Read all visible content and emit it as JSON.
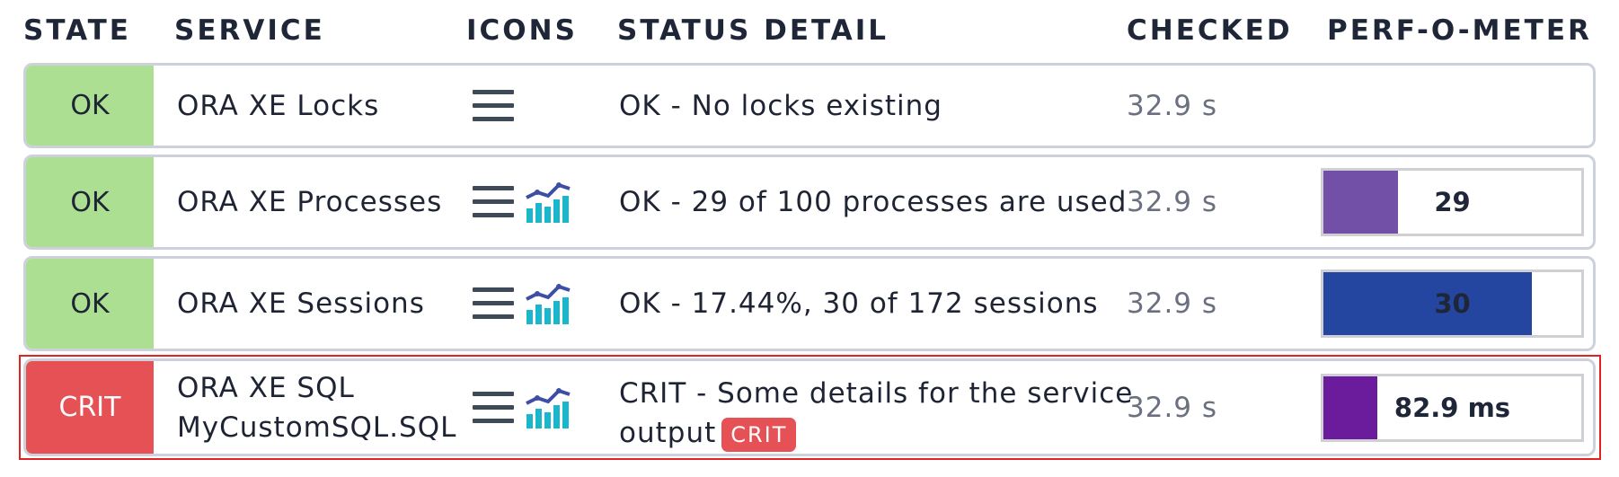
{
  "headers": {
    "state": "STATE",
    "service": "SERVICE",
    "icons": "ICONS",
    "status_detail": "STATUS DETAIL",
    "checked": "CHECKED",
    "perf": "PERF-O-METER"
  },
  "colors": {
    "ok": "#addf93",
    "crit": "#e55155",
    "perf_processes": "#7250a8",
    "perf_sessions": "#2446a0",
    "perf_sql": "#6a1c9c",
    "highlight_border": "#e12222"
  },
  "rows": [
    {
      "state": "OK",
      "service": "ORA XE Locks",
      "icons": [
        "menu-icon"
      ],
      "detail": "OK - No locks existing",
      "checked": "32.9 s"
    },
    {
      "state": "OK",
      "service": "ORA XE Processes",
      "icons": [
        "menu-icon",
        "graph-icon"
      ],
      "detail": "OK - 29 of 100 processes are used",
      "checked": "32.9 s",
      "perf": {
        "label": "29",
        "fraction": 0.29
      }
    },
    {
      "state": "OK",
      "service": "ORA XE Sessions",
      "icons": [
        "menu-icon",
        "graph-icon"
      ],
      "detail": "OK - 17.44%, 30 of 172 sessions",
      "checked": "32.9 s",
      "perf": {
        "label": "30",
        "fraction": 0.81
      }
    },
    {
      "state": "CRIT",
      "service_line1": "ORA XE SQL",
      "service_line2": "MyCustomSQL.SQL",
      "icons": [
        "menu-icon",
        "graph-icon"
      ],
      "detail_line1": "CRIT - Some details for the service",
      "detail_line2": "output",
      "detail_badge": "CRIT",
      "checked": "32.9 s",
      "perf": {
        "label": "82.9 ms",
        "fraction": 0.21
      }
    }
  ]
}
